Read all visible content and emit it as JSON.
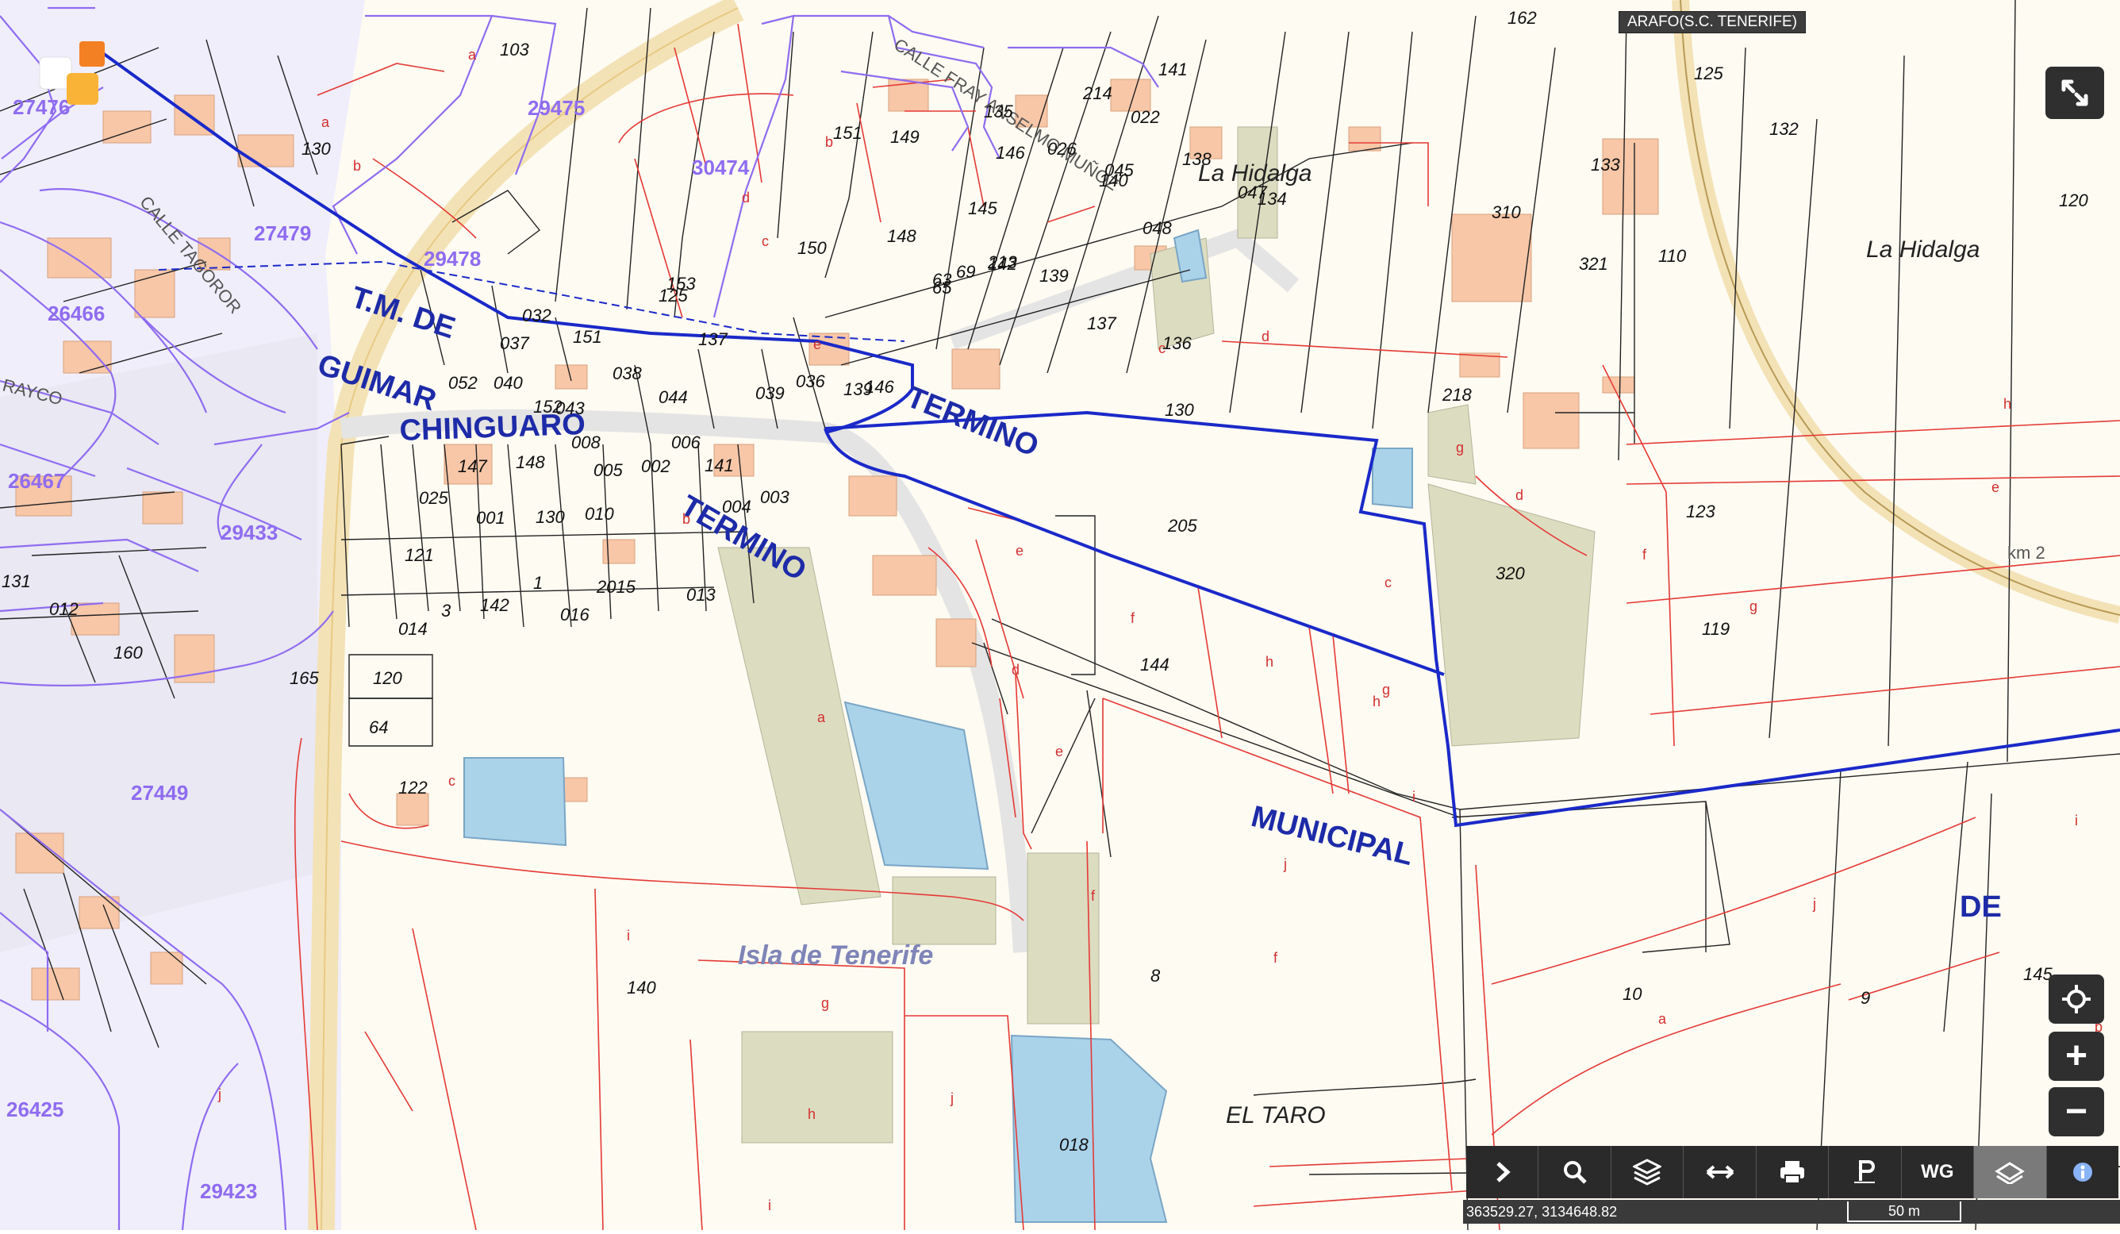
{
  "app": {
    "municipality": "ARAFO(S.C. TENERIFE)",
    "coordinates": "363529.27, 3134648.82",
    "scale_label": "50 m"
  },
  "toolbar": {
    "buttons": [
      "expand-arrow-icon",
      "search-icon",
      "layers-icon",
      "measure-icon",
      "print-icon",
      "parking-icon",
      "wms-icon",
      "cadastre-icon",
      "info-icon"
    ],
    "wms_label": "WG"
  },
  "zoom": {
    "in_label": "+",
    "out_label": "−"
  },
  "colors": {
    "background": "#fdfbf2",
    "parcel_line": "#e53935",
    "block_line": "#222222",
    "zone_line": "#9b7bf0",
    "boundary": "#1a29c9",
    "water": "#aad3ea",
    "green": "#dcdcc0",
    "building": "#f7c7a8",
    "road": "#f3e2b6",
    "street": "#ededed"
  },
  "labels": {
    "large": [
      "T.M. DE",
      "GUIMAR",
      "CHINGUARO",
      "TERMINO",
      "TERMINO",
      "MUNICIPAL",
      "DE"
    ],
    "places": [
      "La Hidalga",
      "La Hidalga",
      "EL TARO",
      "Isla de Tenerife"
    ],
    "streets": [
      "CALLE FRAY ANSELMO MUÑOZ",
      "CALLE TAGOROR",
      "RAYCO"
    ],
    "km": "km 2",
    "zones": [
      "27476",
      "29475",
      "30474",
      "27479",
      "29478",
      "26466",
      "26467",
      "29433",
      "27449",
      "26425",
      "29423"
    ],
    "parcels": [
      "103",
      "130",
      "151",
      "149",
      "150",
      "153",
      "148",
      "139",
      "137",
      "136",
      "134",
      "133",
      "132",
      "125",
      "122",
      "120",
      "110",
      "162",
      "141",
      "214",
      "022",
      "135",
      "138",
      "146",
      "026",
      "140",
      "045",
      "048",
      "047",
      "142",
      "145",
      "310",
      "321",
      "218",
      "123",
      "119",
      "320",
      "205",
      "144",
      "130",
      "137",
      "125",
      "032",
      "037",
      "151",
      "038",
      "052",
      "040",
      "152",
      "043",
      "044",
      "039",
      "036",
      "139",
      "146",
      "147",
      "148",
      "008",
      "006",
      "005",
      "002",
      "141",
      "004",
      "003",
      "025",
      "001",
      "130",
      "010",
      "121",
      "3",
      "142",
      "1",
      "016",
      "2015",
      "013",
      "014",
      "012",
      "160",
      "131",
      "165",
      "120",
      "64",
      "122",
      "8",
      "140",
      "018",
      "10",
      "9",
      "145",
      "63",
      "65",
      "69",
      "213",
      "334",
      "335",
      "142"
    ],
    "sub": [
      "a",
      "b",
      "c",
      "d",
      "e",
      "f",
      "g",
      "h",
      "i",
      "j"
    ]
  }
}
